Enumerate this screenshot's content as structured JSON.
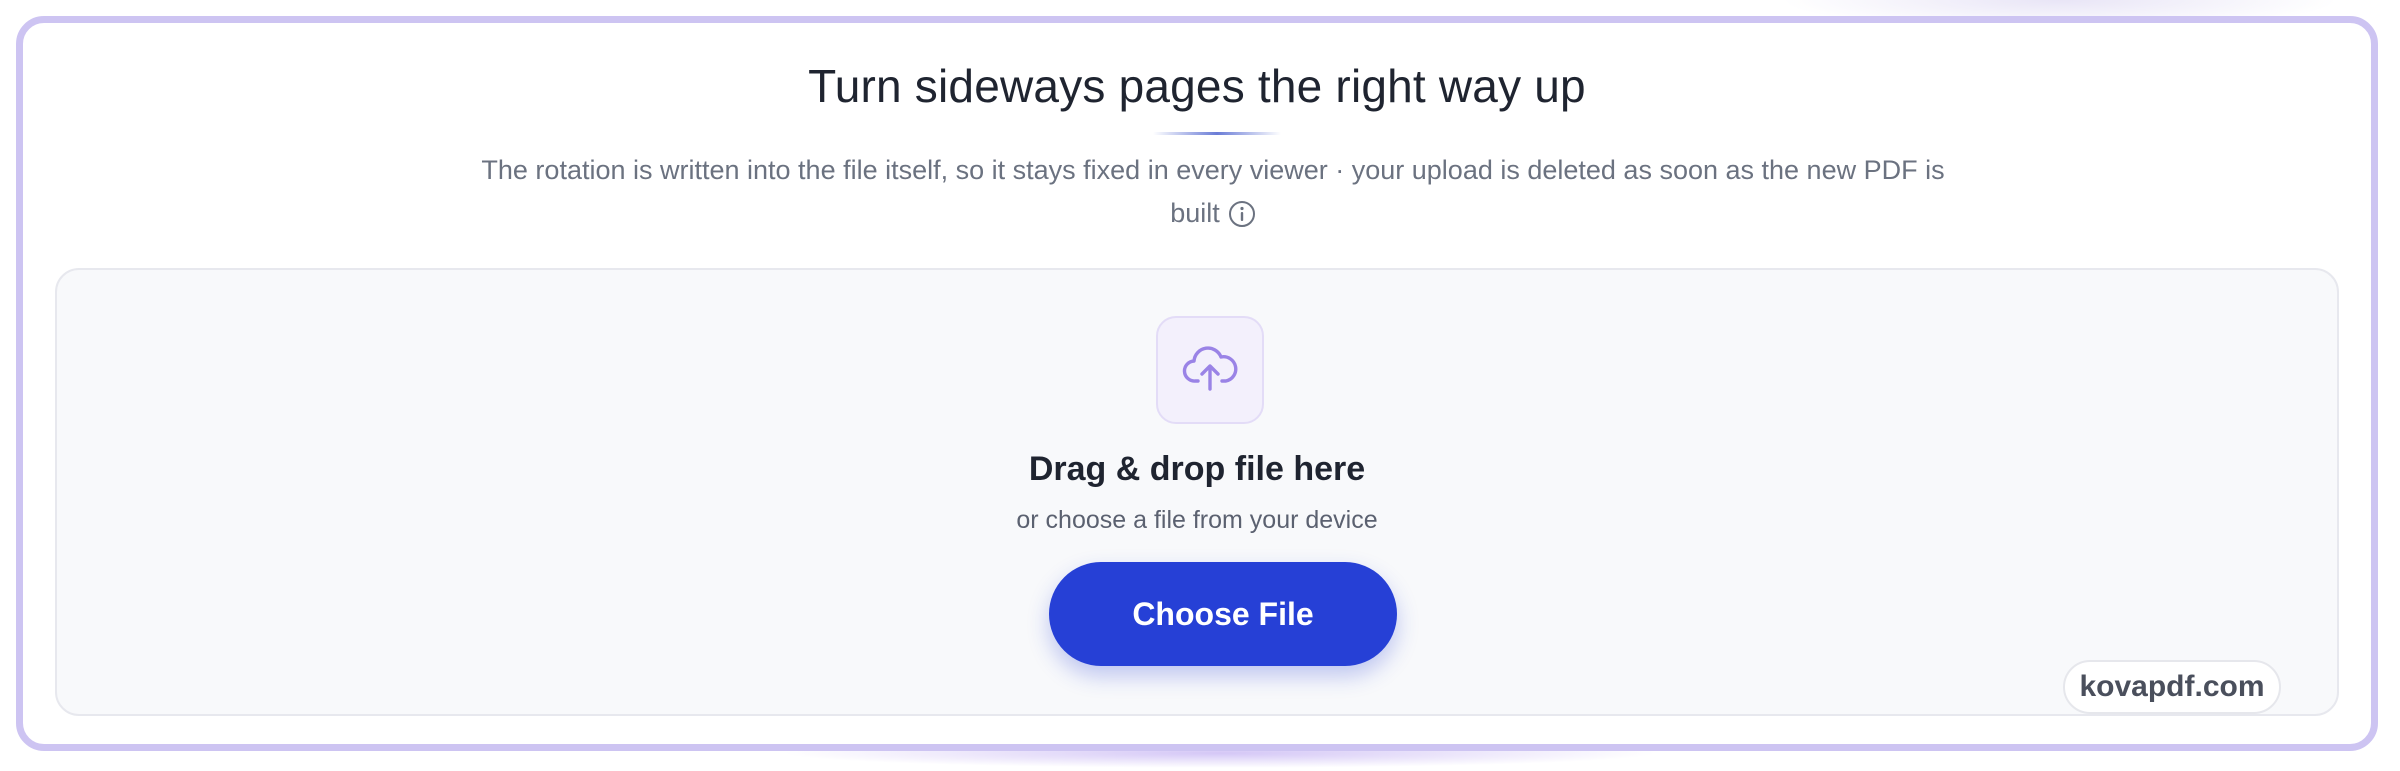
{
  "header": {
    "title": "Turn sideways pages the right way up",
    "subtitle": "The rotation is written into the file itself, so it stays fixed in every viewer · your upload is deleted as soon as the new PDF is built"
  },
  "dropzone": {
    "icon": "cloud-upload-icon",
    "title": "Drag & drop file here",
    "subtitle": "or choose a file from your device",
    "button_label": "Choose File"
  },
  "watermark": {
    "text": "kovapdf.com"
  },
  "colors": {
    "accent": "#2640d6",
    "card_border": "#cdc4f2",
    "icon_tint": "#9a83e6",
    "dropzone_bg": "#f8f9fb"
  }
}
